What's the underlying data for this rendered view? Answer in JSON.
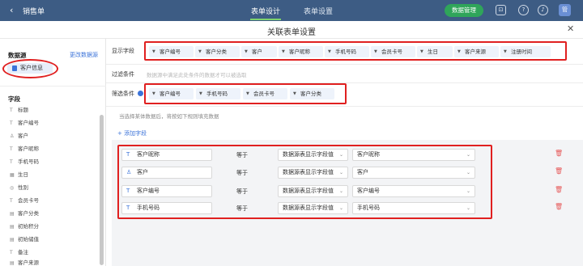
{
  "topbar": {
    "back_icon": "‹",
    "app_title": "销售单",
    "tabs": [
      "表单设计",
      "表单设置"
    ],
    "data_manage_btn": "数据管理",
    "user_initial": "管"
  },
  "dialog": {
    "title": "关联表单设置",
    "close_icon": "✕"
  },
  "left": {
    "datasource_label": "数据源",
    "change_source_link": "更改数据源",
    "source_item": "客户信息",
    "fields_label": "字段",
    "fields": [
      {
        "icon": "T",
        "label": "标题"
      },
      {
        "icon": "T",
        "label": "客户编号"
      },
      {
        "icon": "♙",
        "label": "客户"
      },
      {
        "icon": "T",
        "label": "客户昵称"
      },
      {
        "icon": "T",
        "label": "手机号码"
      },
      {
        "icon": "▦",
        "label": "生日"
      },
      {
        "icon": "◎",
        "label": "性别"
      },
      {
        "icon": "T",
        "label": "会员卡号"
      },
      {
        "icon": "▤",
        "label": "客户分类"
      },
      {
        "icon": "▤",
        "label": "初始积分"
      },
      {
        "icon": "▤",
        "label": "初始储值"
      },
      {
        "icon": "T",
        "label": "备注"
      },
      {
        "icon": "▤",
        "label": "客户来源"
      }
    ]
  },
  "main": {
    "display_fields_label": "显示字段",
    "display_fields": [
      "客户编号",
      "客户分类",
      "客户",
      "客户昵称",
      "手机号码",
      "会员卡号",
      "生日",
      "客户来源",
      "注册时间"
    ],
    "filter_label": "过滤条件",
    "filter_placeholder": "数据源中满足此处条件的数据才可以被选取",
    "filter_fields_label": "筛选条件",
    "filter_fields": [
      "客户编号",
      "手机号码",
      "会员卡号",
      "客户分类"
    ],
    "hint": "当选择某体数据后，将按如下规则填充数据",
    "add_field": "+ 添加字段",
    "mappings": [
      {
        "icon": "T",
        "field": "客户昵称",
        "op": "等于",
        "type": "数据源表显示字段值",
        "source": "客户昵称"
      },
      {
        "icon": "♙",
        "field": "客户",
        "op": "等于",
        "type": "数据源表显示字段值",
        "source": "客户"
      },
      {
        "icon": "T",
        "field": "客户编号",
        "op": "等于",
        "type": "数据源表显示字段值",
        "source": "客户编号"
      },
      {
        "icon": "T",
        "field": "手机号码",
        "op": "等于",
        "type": "数据源表显示字段值",
        "source": "手机号码"
      }
    ]
  },
  "colors": {
    "topbar": "#3d5c84",
    "accent": "#3b73d9",
    "highlight": "#e02020",
    "delete": "#e65a5a"
  }
}
